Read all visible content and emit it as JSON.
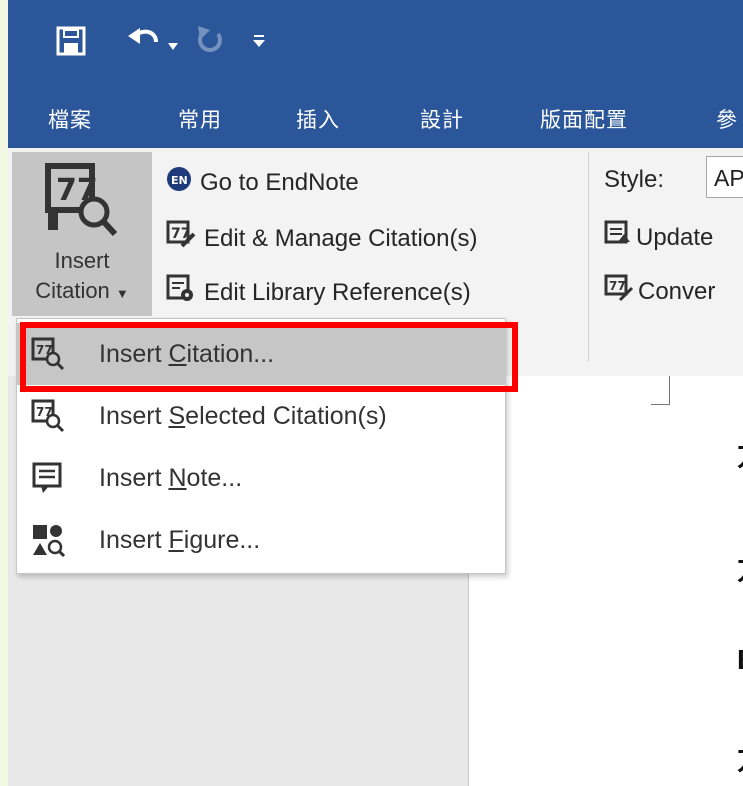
{
  "quick_access": {
    "save_icon": "save-icon",
    "undo_icon": "undo-icon",
    "redo_icon": "redo-icon",
    "customize_icon": "customize-qat-icon"
  },
  "tabs": [
    "檔案",
    "常用",
    "插入",
    "設計",
    "版面配置",
    "參"
  ],
  "ribbon": {
    "insert_citation": {
      "line1": "Insert",
      "line2": "Citation"
    },
    "go_to_endnote": "Go to EndNote",
    "edit_manage": "Edit & Manage Citation(s)",
    "edit_library": "Edit Library Reference(s)",
    "style_label": "Style:",
    "style_value": "AP",
    "update": "Update",
    "convert": "Conver"
  },
  "dropdown": [
    {
      "pre": "Insert ",
      "accel": "C",
      "post": "itation...",
      "icon": "insert-citation-icon",
      "selected": true
    },
    {
      "pre": "Insert ",
      "accel": "S",
      "post": "elected Citation(s)",
      "icon": "insert-selected-citation-icon",
      "selected": false
    },
    {
      "pre": "Insert ",
      "accel": "N",
      "post": "ote...",
      "icon": "insert-note-icon",
      "selected": false
    },
    {
      "pre": "Insert ",
      "accel": "F",
      "post": "igure...",
      "icon": "insert-figure-icon",
      "selected": false
    }
  ],
  "document_lines": [
    "方",
    "方",
    "Ba",
    "方"
  ],
  "colors": {
    "title_bar": "#2b579a",
    "ribbon": "#f3f3f3",
    "highlight_border": "#ff0000",
    "selected_item": "#c6c6c6"
  }
}
